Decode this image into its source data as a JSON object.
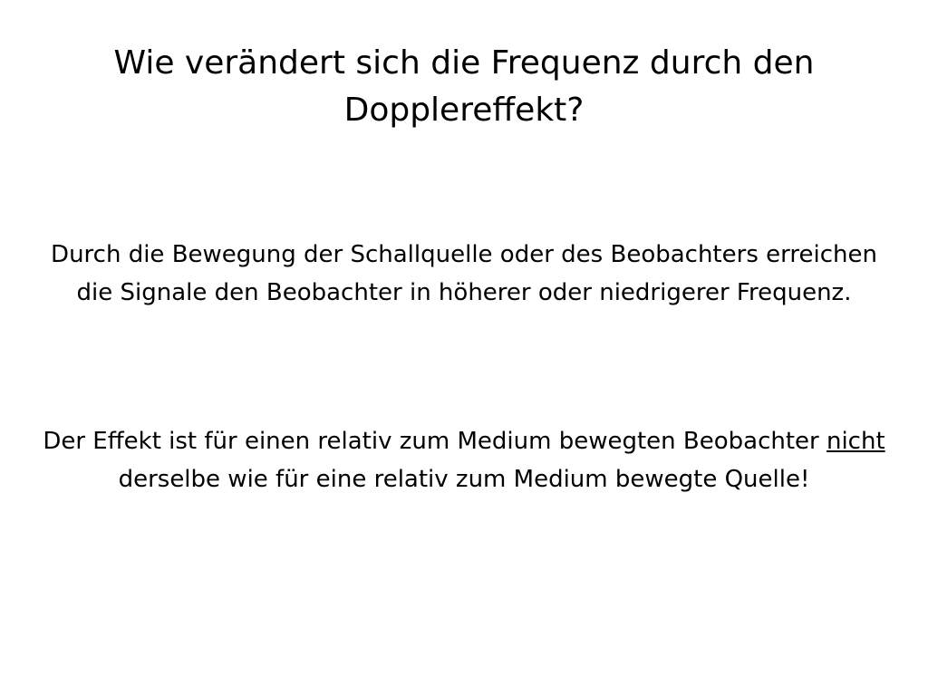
{
  "slide": {
    "title": "Wie verändert sich die Frequenz durch den Dopplereffekt?",
    "paragraph_1": "Durch die Bewegung der Schallquelle oder des Beobachters erreichen die Signale den Beobachter in höherer oder niedrigerer Frequenz.",
    "paragraph_2": {
      "part_1": "Der Effekt ist für einen relativ zum Medium bewegten Beobachter ",
      "emphasis": "nicht",
      "part_2": " derselbe wie für eine relativ zum Medium bewegte Quelle!"
    }
  }
}
